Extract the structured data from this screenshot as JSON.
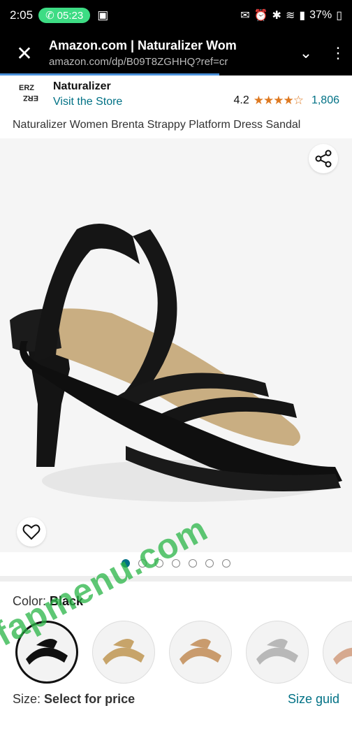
{
  "status_bar": {
    "time": "2:05",
    "call_time": "05:23",
    "battery": "37%"
  },
  "browser": {
    "title": "Amazon.com | Naturalizer Wom",
    "url": "amazon.com/dp/B09T8ZGHHQ?ref=cr"
  },
  "brand": {
    "name": "Naturalizer",
    "store_link": "Visit the Store",
    "logo_text": "ERZ ALIZ"
  },
  "rating": {
    "value": "4.2",
    "stars": "★★★★☆",
    "count": "1,806"
  },
  "product": {
    "title": "Naturalizer Women Brenta Strappy Platform Dress Sandal"
  },
  "gallery": {
    "dot_count": 7,
    "active_index": 0
  },
  "color": {
    "label": "Color:",
    "value": "Black"
  },
  "size": {
    "label": "Size:",
    "value": "Select for price",
    "guide": "Size guid"
  },
  "watermark": "fapmenu.com",
  "colors": {
    "link": "#007185",
    "star": "#de7921",
    "accent": "#4a90d9"
  }
}
